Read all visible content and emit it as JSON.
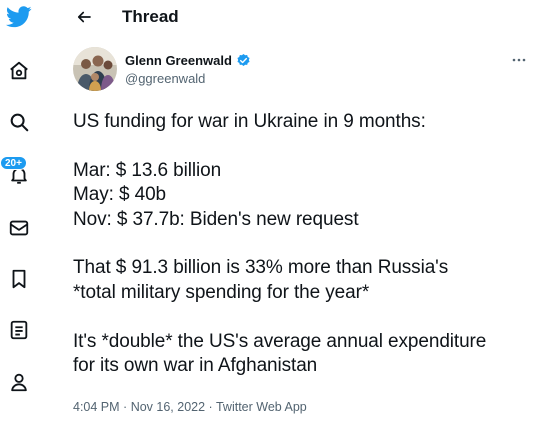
{
  "sidebar": {
    "items": [
      {
        "name": "twitter-logo",
        "icon": "twitter-bird-icon"
      },
      {
        "name": "home",
        "icon": "home-icon"
      },
      {
        "name": "explore",
        "icon": "search-icon"
      },
      {
        "name": "notifications",
        "icon": "bell-icon",
        "badge": "20+"
      },
      {
        "name": "messages",
        "icon": "envelope-icon"
      },
      {
        "name": "bookmarks",
        "icon": "bookmark-icon"
      },
      {
        "name": "lists",
        "icon": "list-icon"
      },
      {
        "name": "profile",
        "icon": "person-icon"
      }
    ]
  },
  "header": {
    "title": "Thread",
    "back_icon": "arrow-left-icon"
  },
  "tweet": {
    "author_name": "Glenn Greenwald",
    "author_handle": "@ggreenwald",
    "verified": true,
    "text": "US funding for war in Ukraine in 9 months:\n\nMar: $ 13.6 billion\nMay: $ 40b\nNov: $ 37.7b: Biden's new request\n\nThat $ 91.3 billion is 33% more than Russia's\n*total military spending for the year*\n\nIt's *double* the US's average annual expenditure\nfor its own war in Afghanistan",
    "time": "4:04 PM",
    "sep1": "·",
    "date": "Nov 16, 2022",
    "sep2": "·",
    "source": "Twitter Web App"
  },
  "colors": {
    "accent": "#1d9bf0",
    "text": "#0f1419",
    "secondary": "#536471"
  }
}
